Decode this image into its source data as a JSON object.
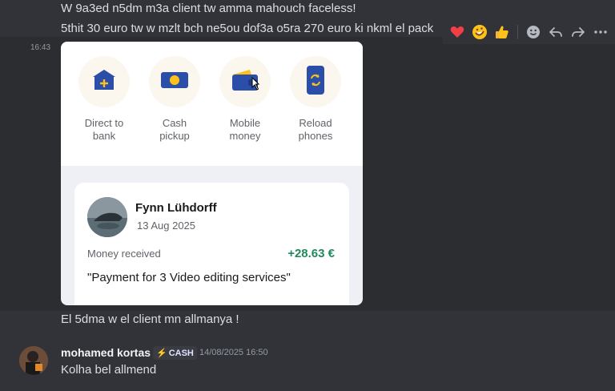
{
  "messages": {
    "line1": "W 9a3ed n5dm m3a client tw amma mahouch faceless!",
    "line2": "5thit 30 euro tw w mzlt bch ne5ou dof3a o5ra 270 euro ki nkml el pack",
    "hover_time": "16:43",
    "line3": "El 5dma w el client mn allmanya !"
  },
  "reaction_bar": {
    "icons": [
      "heart-icon",
      "rofl-emoji-icon",
      "thumbs-up-icon",
      "add-reaction-icon",
      "reply-icon",
      "forward-icon",
      "more-icon"
    ]
  },
  "transfer_card": {
    "options": [
      {
        "label": "Direct to\nbank",
        "icon": "bank-icon"
      },
      {
        "label": "Cash\npickup",
        "icon": "cash-icon"
      },
      {
        "label": "Mobile\nmoney",
        "icon": "wallet-icon"
      },
      {
        "label": "Reload\nphones",
        "icon": "phone-reload-icon"
      }
    ],
    "payment": {
      "name": "Fynn Lühdorff",
      "date": "13 Aug 2025",
      "status": "Money received",
      "amount": "+28.63 €",
      "note": "\"Payment for 3 Video editing services\""
    },
    "colors": {
      "accent_blue": "#2b4fa8",
      "amount_green": "#1f8a5b"
    }
  },
  "author": {
    "username": "mohamed kortas",
    "badge": "CASH",
    "timestamp": "14/08/2025 16:50",
    "message": "Kolha bel allmend"
  }
}
